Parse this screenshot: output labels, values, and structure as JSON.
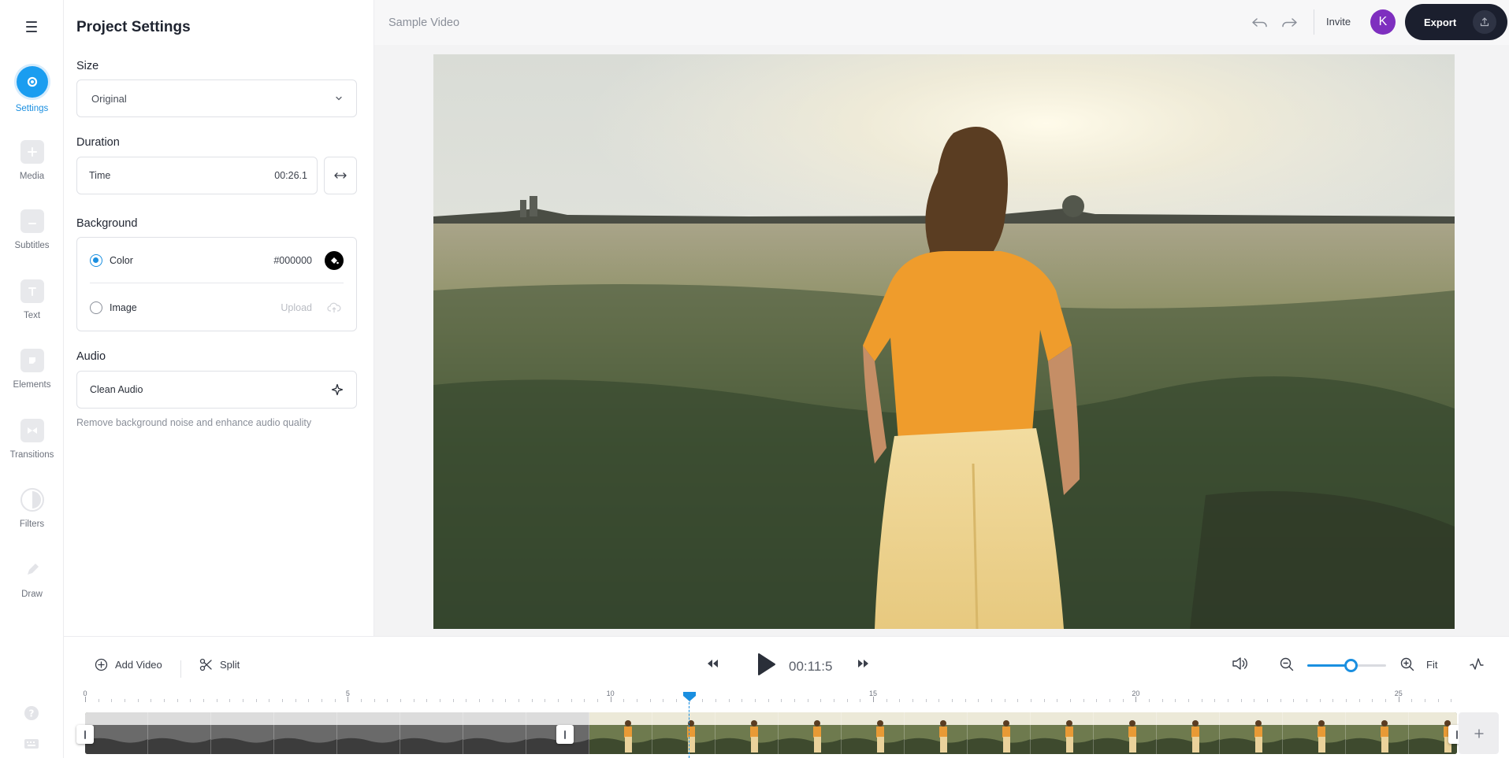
{
  "rail": {
    "items": [
      {
        "label": "Settings",
        "icon": "settings-icon"
      },
      {
        "label": "Media",
        "icon": "media-icon"
      },
      {
        "label": "Subtitles",
        "icon": "subtitles-icon"
      },
      {
        "label": "Text",
        "icon": "text-icon"
      },
      {
        "label": "Elements",
        "icon": "elements-icon"
      },
      {
        "label": "Transitions",
        "icon": "transitions-icon"
      },
      {
        "label": "Filters",
        "icon": "filters-icon"
      },
      {
        "label": "Draw",
        "icon": "draw-icon"
      }
    ]
  },
  "panel": {
    "title": "Project Settings",
    "size": {
      "label": "Size",
      "value": "Original"
    },
    "duration": {
      "label": "Duration",
      "field_label": "Time",
      "value": "00:26.1"
    },
    "background": {
      "label": "Background",
      "color_option": "Color",
      "color_value": "#000000",
      "image_option": "Image",
      "upload_label": "Upload"
    },
    "audio": {
      "label": "Audio",
      "clean_label": "Clean Audio",
      "hint": "Remove background noise and enhance audio quality"
    }
  },
  "topbar": {
    "project_name": "Sample Video",
    "invite": "Invite",
    "avatar_initial": "K",
    "export": "Export"
  },
  "controls": {
    "add_video": "Add Video",
    "split": "Split",
    "timecode": "00:11:5",
    "fit": "Fit",
    "zoom_level": 0.55
  },
  "timeline": {
    "tick_labels": [
      "0",
      "5",
      "10",
      "15",
      "20",
      "25"
    ],
    "duration_seconds": 26.1,
    "playhead_seconds": 11.5
  },
  "colors": {
    "accent": "#1a9df0",
    "export_bg": "#1b1f2e",
    "avatar_bg": "#7e2fbf"
  }
}
